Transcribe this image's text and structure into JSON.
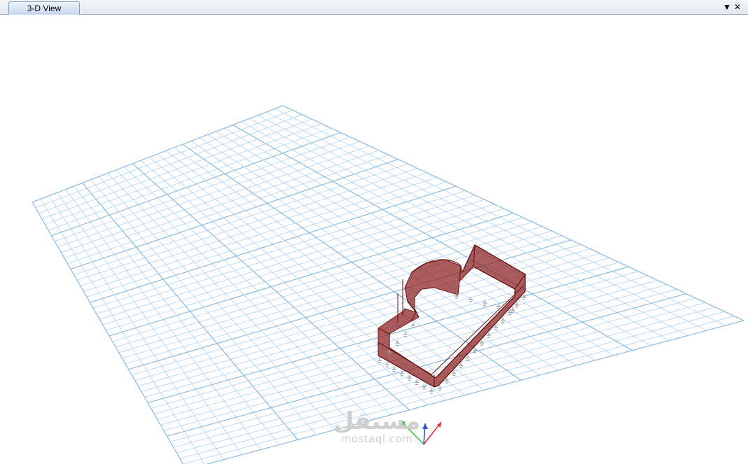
{
  "window": {
    "tab_label": "3-D View",
    "dropdown_icon": "chevron-down-icon",
    "close_icon": "close-icon",
    "dropdown_glyph": "▼",
    "close_glyph": "✕"
  },
  "viewport": {
    "background": "#ffffff",
    "grid_color": "#9fcdef",
    "grid_major_color": "#7fb6e3",
    "model_fill": "#8b1d1d",
    "model_stroke": "#7a1010",
    "support_color": "#9a9a9a"
  },
  "axes": {
    "x_color": "#e03030",
    "y_color": "#30c030",
    "z_color": "#3050d0"
  },
  "watermark": {
    "arabic": "مستقل",
    "latin": "mostaql.com"
  }
}
